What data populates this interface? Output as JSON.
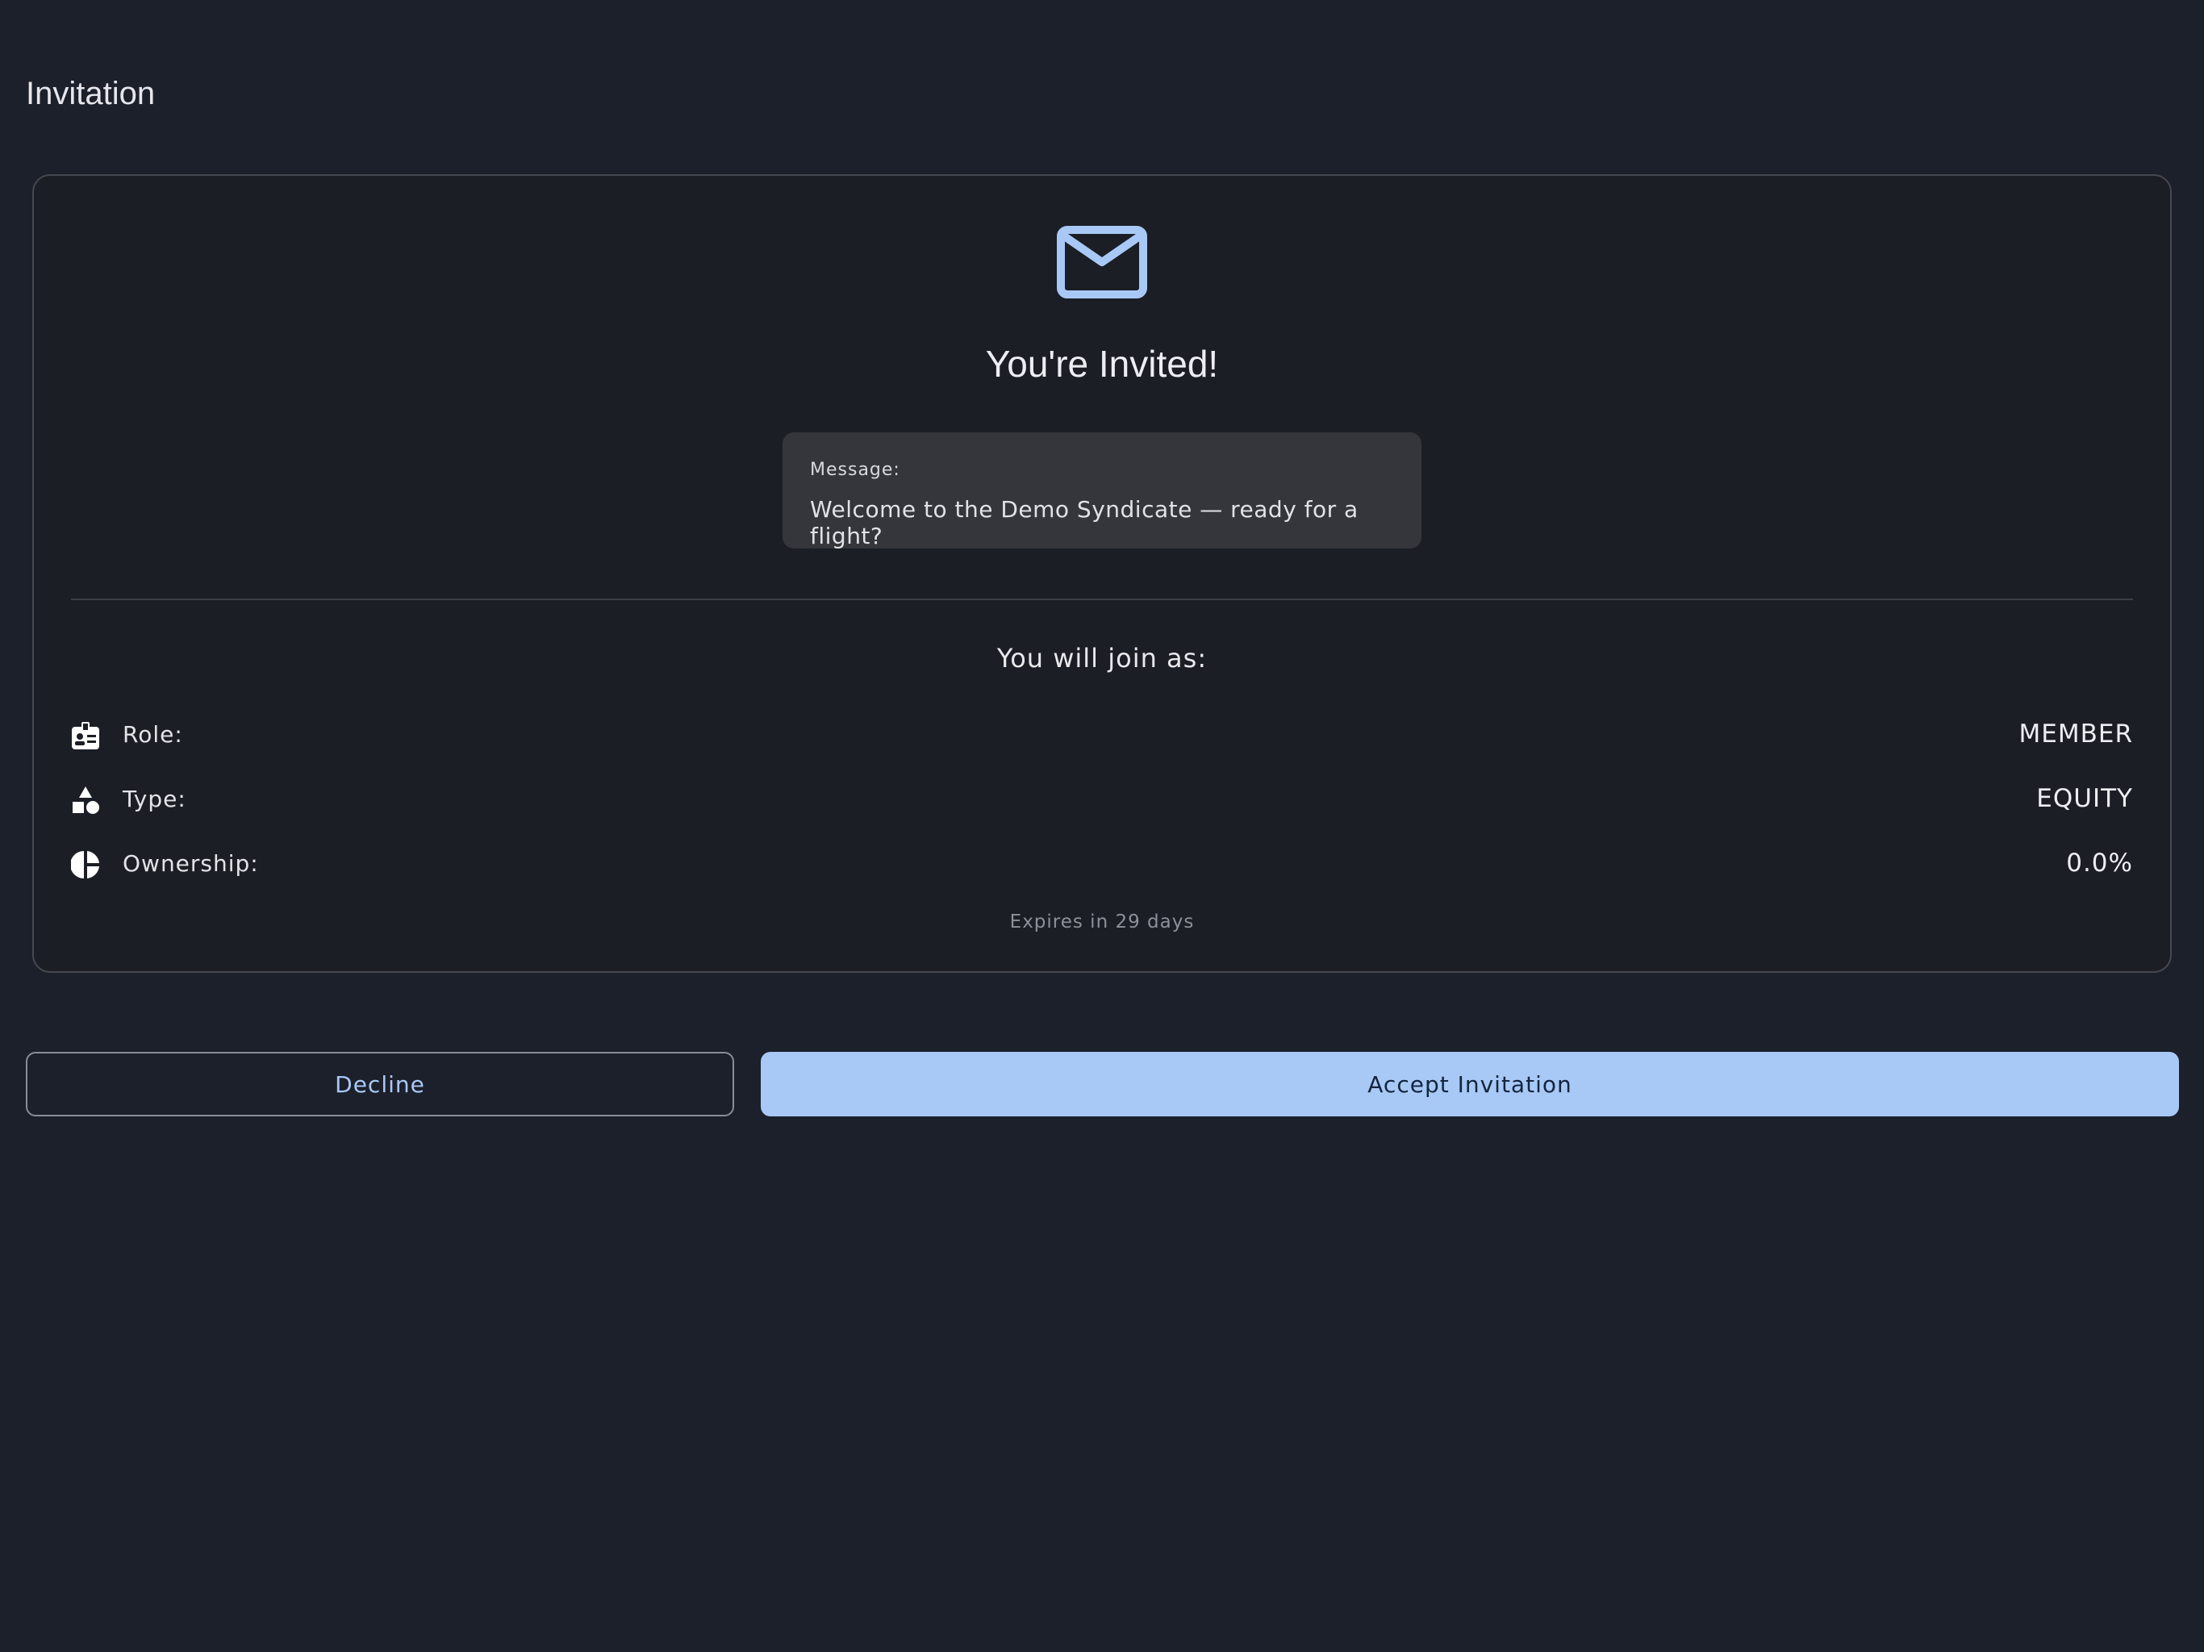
{
  "header": {
    "title": "Invitation"
  },
  "invite": {
    "icon": "mail-icon",
    "title": "You're Invited!",
    "message_label": "Message:",
    "message_text": "Welcome to the Demo Syndicate — ready for a flight?",
    "join_heading": "You will join as:",
    "details": [
      {
        "icon": "badge-icon",
        "label": "Role:",
        "value": "MEMBER"
      },
      {
        "icon": "shapes-icon",
        "label": "Type:",
        "value": "EQUITY"
      },
      {
        "icon": "pie-chart-icon",
        "label": "Ownership:",
        "value": "0.0%"
      }
    ],
    "expires": "Expires in 29 days"
  },
  "actions": {
    "decline_label": "Decline",
    "accept_label": "Accept Invitation"
  },
  "colors": {
    "background": "#1c202b",
    "card": "#1b1e24",
    "accent": "#a8c9f6",
    "accent_text": "#13253f"
  }
}
